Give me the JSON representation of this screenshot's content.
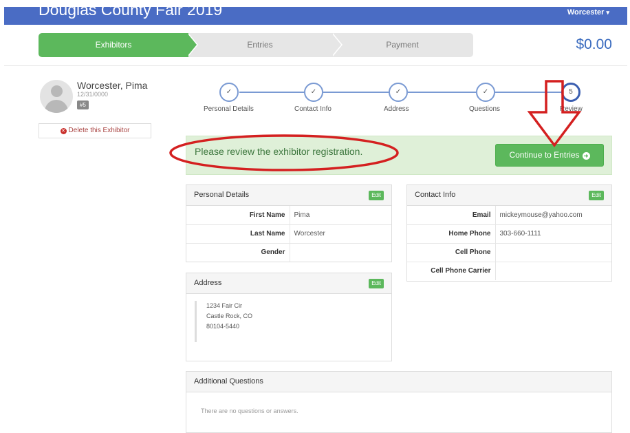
{
  "header": {
    "title": "Douglas County Fair 2019",
    "user": "Worcester"
  },
  "cart": {
    "total": "$0.00"
  },
  "progress": {
    "steps": [
      "Exhibitors",
      "Entries",
      "Payment"
    ],
    "active": "Exhibitors"
  },
  "exhibitor": {
    "name": "Worcester, Pima",
    "birthdate": "12/31/0000",
    "badge": "#5",
    "delete_label": "Delete this Exhibitor"
  },
  "wizard": {
    "steps": [
      {
        "label": "Personal Details",
        "marker": "✓"
      },
      {
        "label": "Contact Info",
        "marker": "✓"
      },
      {
        "label": "Address",
        "marker": "✓"
      },
      {
        "label": "Questions",
        "marker": "✓"
      },
      {
        "label": "Review",
        "marker": "5"
      }
    ]
  },
  "alert": {
    "message": "Please review the exhibitor registration.",
    "continue_label": "Continue to Entries"
  },
  "personal": {
    "title": "Personal Details",
    "edit_label": "Edit",
    "rows": [
      {
        "label": "First Name",
        "value": "Pima"
      },
      {
        "label": "Last Name",
        "value": "Worcester"
      },
      {
        "label": "Gender",
        "value": ""
      }
    ]
  },
  "contact": {
    "title": "Contact Info",
    "edit_label": "Edit",
    "rows": [
      {
        "label": "Email",
        "value": "mickeymouse@yahoo.com"
      },
      {
        "label": "Home Phone",
        "value": "303-660-1111"
      },
      {
        "label": "Cell Phone",
        "value": ""
      },
      {
        "label": "Cell Phone Carrier",
        "value": ""
      }
    ]
  },
  "address": {
    "title": "Address",
    "edit_label": "Edit",
    "line1": "1234 Fair Cir",
    "line2": "Castle Rock, CO",
    "line3": "80104-5440"
  },
  "questions": {
    "title": "Additional Questions",
    "empty": "There are no questions or answers."
  },
  "colors": {
    "brand_blue": "#4a6cc4",
    "success_green": "#5cb85c",
    "alert_bg": "#dff0d8",
    "annotation_red": "#d42020"
  }
}
